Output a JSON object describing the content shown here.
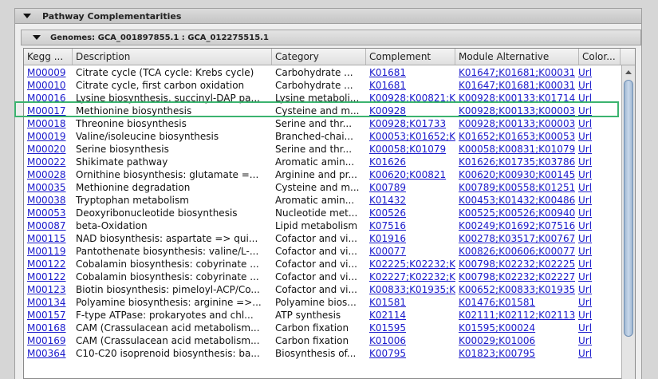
{
  "panel": {
    "title": "Pathway Complementarities"
  },
  "genomes": {
    "title": "Genomes: GCA_001897855.1 : GCA_012275515.1"
  },
  "table": {
    "columns": [
      "Kegg ...",
      "Description",
      "Category",
      "Complement",
      "Module Alternative",
      "Color..."
    ],
    "rows": [
      [
        "M00009",
        "Citrate cycle (TCA cycle: Krebs cycle)",
        "Carbohydrate ...",
        "K01681",
        "K01647;K01681;K00031",
        "Url"
      ],
      [
        "M00010",
        "Citrate cycle, first carbon oxidation",
        "Carbohydrate ...",
        "K01681",
        "K01647;K01681;K00031",
        "Url"
      ],
      [
        "M00016",
        "Lysine biosynthesis, succinyl-DAP pa...",
        "Lysine metaboli...",
        "K00928;K00821;K",
        "K00928;K00133;K01714",
        "Url"
      ],
      [
        "M00017",
        "Methionine biosynthesis",
        "Cysteine and m...",
        "K00928",
        "K00928;K00133;K00003",
        "Url"
      ],
      [
        "M00018",
        "Threonine biosynthesis",
        "Serine and thr...",
        "K00928;K01733",
        "K00928;K00133;K00003",
        "Url"
      ],
      [
        "M00019",
        "Valine/isoleucine biosynthesis",
        "Branched-chai...",
        "K00053;K01652;K",
        "K01652;K01653;K00053",
        "Url"
      ],
      [
        "M00020",
        "Serine biosynthesis",
        "Serine and thr...",
        "K00058;K01079",
        "K00058;K00831;K01079",
        "Url"
      ],
      [
        "M00022",
        "Shikimate pathway",
        "Aromatic amin...",
        "K01626",
        "K01626;K01735;K03786",
        "Url"
      ],
      [
        "M00028",
        "Ornithine biosynthesis: glutamate =...",
        "Arginine and pr...",
        "K00620;K00821",
        "K00620;K00930;K00145",
        "Url"
      ],
      [
        "M00035",
        "Methionine degradation",
        "Cysteine and m...",
        "K00789",
        "K00789;K00558;K01251",
        "Url"
      ],
      [
        "M00038",
        "Tryptophan metabolism",
        "Aromatic amin...",
        "K01432",
        "K00453;K01432;K00486",
        "Url"
      ],
      [
        "M00053",
        "Deoxyribonucleotide biosynthesis",
        "Nucleotide met...",
        "K00526",
        "K00525;K00526;K00940",
        "Url"
      ],
      [
        "M00087",
        "beta-Oxidation",
        "Lipid metabolism",
        "K07516",
        "K00249;K01692;K07516",
        "Url"
      ],
      [
        "M00115",
        "NAD biosynthesis: aspartate => qui...",
        "Cofactor and vi...",
        "K01916",
        "K00278;K03517;K00767",
        "Url"
      ],
      [
        "M00119",
        "Pantothenate biosynthesis: valine/L-...",
        "Cofactor and vi...",
        "K00077",
        "K00826;K00606;K00077",
        "Url"
      ],
      [
        "M00122",
        "Cobalamin biosynthesis: cobyrinate ...",
        "Cofactor and vi...",
        "K02225;K02232;K",
        "K00798;K02232;K02225",
        "Url"
      ],
      [
        "M00122",
        "Cobalamin biosynthesis: cobyrinate ...",
        "Cofactor and vi...",
        "K02227;K02232;K",
        "K00798;K02232;K02227",
        "Url"
      ],
      [
        "M00123",
        "Biotin biosynthesis: pimeloyl-ACP/Co...",
        "Cofactor and vi...",
        "K00833;K01935;K",
        "K00652;K00833;K01935",
        "Url"
      ],
      [
        "M00134",
        "Polyamine biosynthesis: arginine =>...",
        "Polyamine bios...",
        "K01581",
        "K01476;K01581",
        "Url"
      ],
      [
        "M00157",
        "F-type ATPase: prokaryotes and chl...",
        "ATP synthesis",
        "K02114",
        "K02111;K02112;K02113",
        "Url"
      ],
      [
        "M00168",
        "CAM (Crassulacean acid metabolism...",
        "Carbon fixation",
        "K01595",
        "K01595;K00024",
        "Url"
      ],
      [
        "M00169",
        "CAM (Crassulacean acid metabolism...",
        "Carbon fixation",
        "K01006",
        "K00029;K01006",
        "Url"
      ],
      [
        "M00364",
        "C10-C20 isoprenoid biosynthesis: ba...",
        "Biosynthesis of...",
        "K00795",
        "K01823;K00795",
        "Url"
      ]
    ],
    "selected_row": 3
  }
}
